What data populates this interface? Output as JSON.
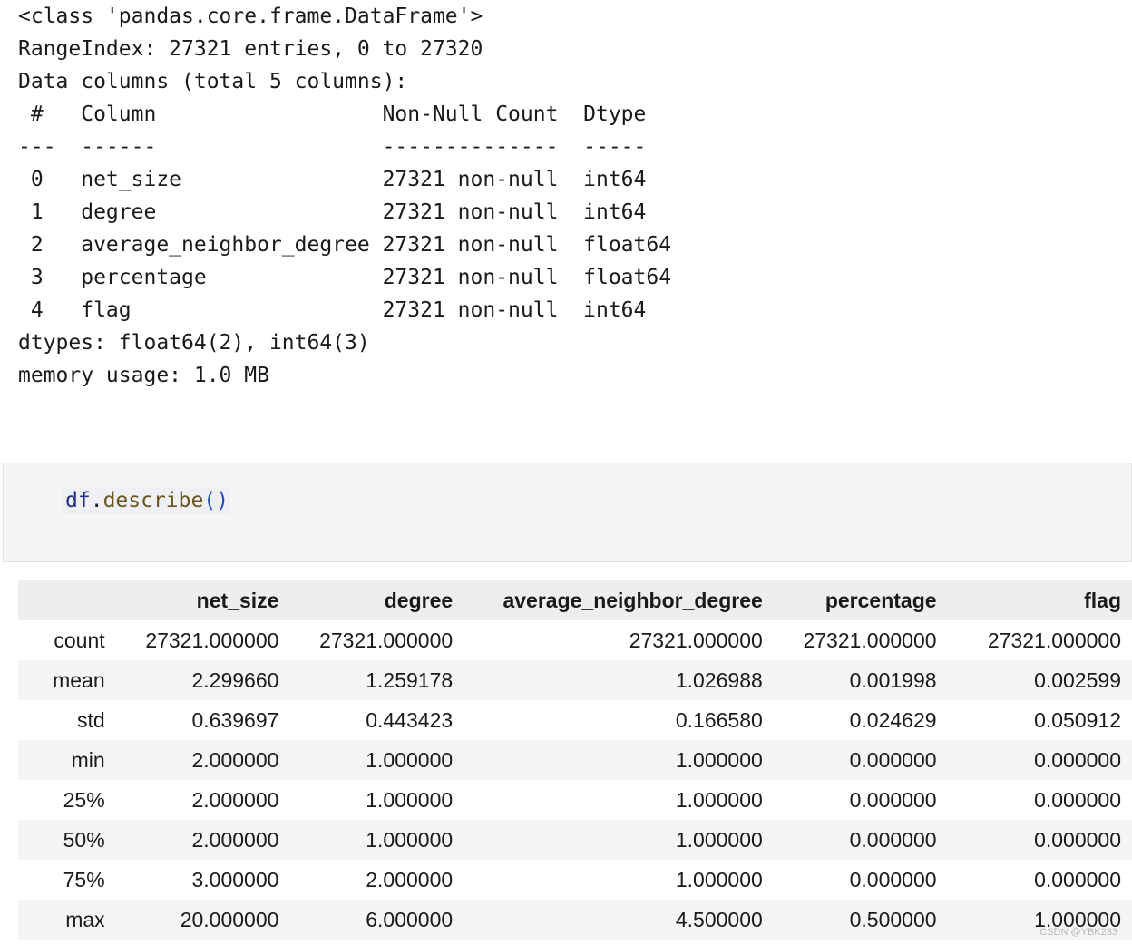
{
  "info_output": {
    "lines": [
      "<class 'pandas.core.frame.DataFrame'>",
      "RangeIndex: 27321 entries, 0 to 27320",
      "Data columns (total 5 columns):",
      " #   Column                  Non-Null Count  Dtype  ",
      "---  ------                  --------------  -----  ",
      " 0   net_size                27321 non-null  int64  ",
      " 1   degree                  27321 non-null  int64  ",
      " 2   average_neighbor_degree 27321 non-null  float64",
      " 3   percentage              27321 non-null  float64",
      " 4   flag                    27321 non-null  int64  ",
      "dtypes: float64(2), int64(3)",
      "memory usage: 1.0 MB"
    ]
  },
  "code_cell": {
    "var": "df",
    "dot": ".",
    "method": "describe",
    "parens": "()"
  },
  "describe_table": {
    "columns": [
      "",
      "net_size",
      "degree",
      "average_neighbor_degree",
      "percentage",
      "flag"
    ],
    "rows": [
      {
        "label": "count",
        "values": [
          "27321.000000",
          "27321.000000",
          "27321.000000",
          "27321.000000",
          "27321.000000"
        ]
      },
      {
        "label": "mean",
        "values": [
          "2.299660",
          "1.259178",
          "1.026988",
          "0.001998",
          "0.002599"
        ]
      },
      {
        "label": "std",
        "values": [
          "0.639697",
          "0.443423",
          "0.166580",
          "0.024629",
          "0.050912"
        ]
      },
      {
        "label": "min",
        "values": [
          "2.000000",
          "1.000000",
          "1.000000",
          "0.000000",
          "0.000000"
        ]
      },
      {
        "label": "25%",
        "values": [
          "2.000000",
          "1.000000",
          "1.000000",
          "0.000000",
          "0.000000"
        ]
      },
      {
        "label": "50%",
        "values": [
          "2.000000",
          "1.000000",
          "1.000000",
          "0.000000",
          "0.000000"
        ]
      },
      {
        "label": "75%",
        "values": [
          "3.000000",
          "2.000000",
          "1.000000",
          "0.000000",
          "0.000000"
        ]
      },
      {
        "label": "max",
        "values": [
          "20.000000",
          "6.000000",
          "4.500000",
          "0.500000",
          "1.000000"
        ]
      }
    ]
  },
  "watermark": "CSDN @YBK233"
}
